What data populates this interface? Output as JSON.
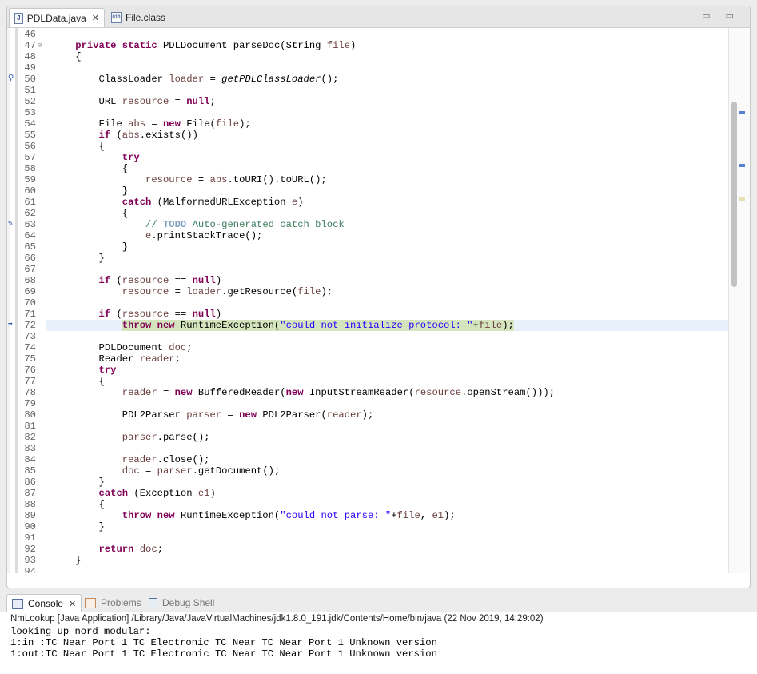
{
  "editor": {
    "tabs": [
      {
        "label": "PDLData.java",
        "icon": "J",
        "close": "✕"
      },
      {
        "label": "File.class",
        "icon": "010"
      }
    ],
    "window_controls": "▭ ▭",
    "lines": [
      {
        "n": "46",
        "code": [
          {
            "t": ""
          }
        ]
      },
      {
        "n": "47",
        "fold": "⊖",
        "code": [
          {
            "t": "    "
          },
          {
            "t": "private static",
            "c": "kw"
          },
          {
            "t": " PDLDocument parseDoc(String "
          },
          {
            "t": "file",
            "c": "var"
          },
          {
            "t": ")"
          }
        ]
      },
      {
        "n": "48",
        "code": [
          {
            "t": "    {"
          }
        ]
      },
      {
        "n": "49",
        "code": [
          {
            "t": ""
          }
        ]
      },
      {
        "n": "50",
        "marker": "⚲",
        "code": [
          {
            "t": "        ClassLoader "
          },
          {
            "t": "loader",
            "c": "var"
          },
          {
            "t": " = "
          },
          {
            "t": "getPDLClassLoader",
            "c": "it"
          },
          {
            "t": "();"
          }
        ]
      },
      {
        "n": "51",
        "code": [
          {
            "t": ""
          }
        ]
      },
      {
        "n": "52",
        "code": [
          {
            "t": "        URL "
          },
          {
            "t": "resource",
            "c": "var"
          },
          {
            "t": " = "
          },
          {
            "t": "null",
            "c": "kw"
          },
          {
            "t": ";"
          }
        ]
      },
      {
        "n": "53",
        "code": [
          {
            "t": ""
          }
        ]
      },
      {
        "n": "54",
        "code": [
          {
            "t": "        File "
          },
          {
            "t": "abs",
            "c": "var"
          },
          {
            "t": " = "
          },
          {
            "t": "new",
            "c": "kw"
          },
          {
            "t": " File("
          },
          {
            "t": "file",
            "c": "var"
          },
          {
            "t": ");"
          }
        ]
      },
      {
        "n": "55",
        "code": [
          {
            "t": "        "
          },
          {
            "t": "if",
            "c": "kw"
          },
          {
            "t": " ("
          },
          {
            "t": "abs",
            "c": "var"
          },
          {
            "t": ".exists())"
          }
        ]
      },
      {
        "n": "56",
        "code": [
          {
            "t": "        {"
          }
        ]
      },
      {
        "n": "57",
        "code": [
          {
            "t": "            "
          },
          {
            "t": "try",
            "c": "kw"
          }
        ]
      },
      {
        "n": "58",
        "code": [
          {
            "t": "            {"
          }
        ]
      },
      {
        "n": "59",
        "code": [
          {
            "t": "                "
          },
          {
            "t": "resource",
            "c": "var"
          },
          {
            "t": " = "
          },
          {
            "t": "abs",
            "c": "var"
          },
          {
            "t": ".toURI().toURL();"
          }
        ]
      },
      {
        "n": "60",
        "code": [
          {
            "t": "            }"
          }
        ]
      },
      {
        "n": "61",
        "code": [
          {
            "t": "            "
          },
          {
            "t": "catch",
            "c": "kw"
          },
          {
            "t": " (MalformedURLException "
          },
          {
            "t": "e",
            "c": "var"
          },
          {
            "t": ")"
          }
        ]
      },
      {
        "n": "62",
        "code": [
          {
            "t": "            {"
          }
        ]
      },
      {
        "n": "63",
        "marker": "✎",
        "code": [
          {
            "t": "                "
          },
          {
            "t": "// ",
            "c": "cmt"
          },
          {
            "t": "TODO",
            "c": "todo"
          },
          {
            "t": " Auto-generated catch block",
            "c": "cmt"
          }
        ]
      },
      {
        "n": "64",
        "code": [
          {
            "t": "                "
          },
          {
            "t": "e",
            "c": "var"
          },
          {
            "t": ".printStackTrace();"
          }
        ]
      },
      {
        "n": "65",
        "code": [
          {
            "t": "            }"
          }
        ]
      },
      {
        "n": "66",
        "code": [
          {
            "t": "        }"
          }
        ]
      },
      {
        "n": "67",
        "code": [
          {
            "t": ""
          }
        ]
      },
      {
        "n": "68",
        "code": [
          {
            "t": "        "
          },
          {
            "t": "if",
            "c": "kw"
          },
          {
            "t": " ("
          },
          {
            "t": "resource",
            "c": "var"
          },
          {
            "t": " == "
          },
          {
            "t": "null",
            "c": "kw"
          },
          {
            "t": ")"
          }
        ]
      },
      {
        "n": "69",
        "code": [
          {
            "t": "            "
          },
          {
            "t": "resource",
            "c": "var"
          },
          {
            "t": " = "
          },
          {
            "t": "loader",
            "c": "var"
          },
          {
            "t": ".getResource("
          },
          {
            "t": "file",
            "c": "var"
          },
          {
            "t": ");"
          }
        ]
      },
      {
        "n": "70",
        "code": [
          {
            "t": ""
          }
        ]
      },
      {
        "n": "71",
        "code": [
          {
            "t": "        "
          },
          {
            "t": "if",
            "c": "kw"
          },
          {
            "t": " ("
          },
          {
            "t": "resource",
            "c": "var"
          },
          {
            "t": " == "
          },
          {
            "t": "null",
            "c": "kw"
          },
          {
            "t": ")"
          }
        ]
      },
      {
        "n": "72",
        "marker": "➡",
        "current": true,
        "code": [
          {
            "t": "            "
          },
          {
            "t": "throw new",
            "c": "kw hl"
          },
          {
            "t": " RuntimeException(",
            "c": "hl"
          },
          {
            "t": "\"could not initialize protocol: \"",
            "c": "str hl"
          },
          {
            "t": "+",
            "c": "hl"
          },
          {
            "t": "file",
            "c": "var hl"
          },
          {
            "t": ");",
            "c": "hl"
          }
        ]
      },
      {
        "n": "73",
        "code": [
          {
            "t": ""
          }
        ]
      },
      {
        "n": "74",
        "code": [
          {
            "t": "        PDLDocument "
          },
          {
            "t": "doc",
            "c": "var"
          },
          {
            "t": ";"
          }
        ]
      },
      {
        "n": "75",
        "code": [
          {
            "t": "        Reader "
          },
          {
            "t": "reader",
            "c": "var"
          },
          {
            "t": ";"
          }
        ]
      },
      {
        "n": "76",
        "code": [
          {
            "t": "        "
          },
          {
            "t": "try",
            "c": "kw"
          }
        ]
      },
      {
        "n": "77",
        "code": [
          {
            "t": "        {"
          }
        ]
      },
      {
        "n": "78",
        "code": [
          {
            "t": "            "
          },
          {
            "t": "reader",
            "c": "var"
          },
          {
            "t": " = "
          },
          {
            "t": "new",
            "c": "kw"
          },
          {
            "t": " BufferedReader("
          },
          {
            "t": "new",
            "c": "kw"
          },
          {
            "t": " InputStreamReader("
          },
          {
            "t": "resource",
            "c": "var"
          },
          {
            "t": ".openStream()));"
          }
        ]
      },
      {
        "n": "79",
        "code": [
          {
            "t": ""
          }
        ]
      },
      {
        "n": "80",
        "code": [
          {
            "t": "            PDL2Parser "
          },
          {
            "t": "parser",
            "c": "var"
          },
          {
            "t": " = "
          },
          {
            "t": "new",
            "c": "kw"
          },
          {
            "t": " PDL2Parser("
          },
          {
            "t": "reader",
            "c": "var"
          },
          {
            "t": ");"
          }
        ]
      },
      {
        "n": "81",
        "code": [
          {
            "t": ""
          }
        ]
      },
      {
        "n": "82",
        "code": [
          {
            "t": "            "
          },
          {
            "t": "parser",
            "c": "var"
          },
          {
            "t": ".parse();"
          }
        ]
      },
      {
        "n": "83",
        "code": [
          {
            "t": ""
          }
        ]
      },
      {
        "n": "84",
        "code": [
          {
            "t": "            "
          },
          {
            "t": "reader",
            "c": "var"
          },
          {
            "t": ".close();"
          }
        ]
      },
      {
        "n": "85",
        "code": [
          {
            "t": "            "
          },
          {
            "t": "doc",
            "c": "var"
          },
          {
            "t": " = "
          },
          {
            "t": "parser",
            "c": "var"
          },
          {
            "t": ".getDocument();"
          }
        ]
      },
      {
        "n": "86",
        "code": [
          {
            "t": "        }"
          }
        ]
      },
      {
        "n": "87",
        "code": [
          {
            "t": "        "
          },
          {
            "t": "catch",
            "c": "kw"
          },
          {
            "t": " (Exception "
          },
          {
            "t": "e1",
            "c": "var"
          },
          {
            "t": ")"
          }
        ]
      },
      {
        "n": "88",
        "code": [
          {
            "t": "        {"
          }
        ]
      },
      {
        "n": "89",
        "code": [
          {
            "t": "            "
          },
          {
            "t": "throw new",
            "c": "kw"
          },
          {
            "t": " RuntimeException("
          },
          {
            "t": "\"could not parse: \"",
            "c": "str"
          },
          {
            "t": "+"
          },
          {
            "t": "file",
            "c": "var"
          },
          {
            "t": ", "
          },
          {
            "t": "e1",
            "c": "var"
          },
          {
            "t": ");"
          }
        ]
      },
      {
        "n": "90",
        "code": [
          {
            "t": "        }"
          }
        ]
      },
      {
        "n": "91",
        "code": [
          {
            "t": ""
          }
        ]
      },
      {
        "n": "92",
        "code": [
          {
            "t": "        "
          },
          {
            "t": "return",
            "c": "kw"
          },
          {
            "t": " "
          },
          {
            "t": "doc",
            "c": "var"
          },
          {
            "t": ";"
          }
        ]
      },
      {
        "n": "93",
        "code": [
          {
            "t": "    }"
          }
        ]
      },
      {
        "n": "94",
        "code": [
          {
            "t": ""
          }
        ]
      }
    ]
  },
  "console": {
    "tabs": [
      {
        "label": "Console",
        "close": "✕"
      },
      {
        "label": "Problems"
      },
      {
        "label": "Debug Shell"
      }
    ],
    "description": "NmLookup [Java Application] /Library/Java/JavaVirtualMachines/jdk1.8.0_191.jdk/Contents/Home/bin/java (22 Nov 2019, 14:29:02)",
    "output": [
      "looking up nord modular:",
      "1:in :TC Near Port 1 TC Electronic TC Near TC Near Port 1 Unknown version",
      "1:out:TC Near Port 1 TC Electronic TC Near TC Near Port 1 Unknown version"
    ]
  }
}
